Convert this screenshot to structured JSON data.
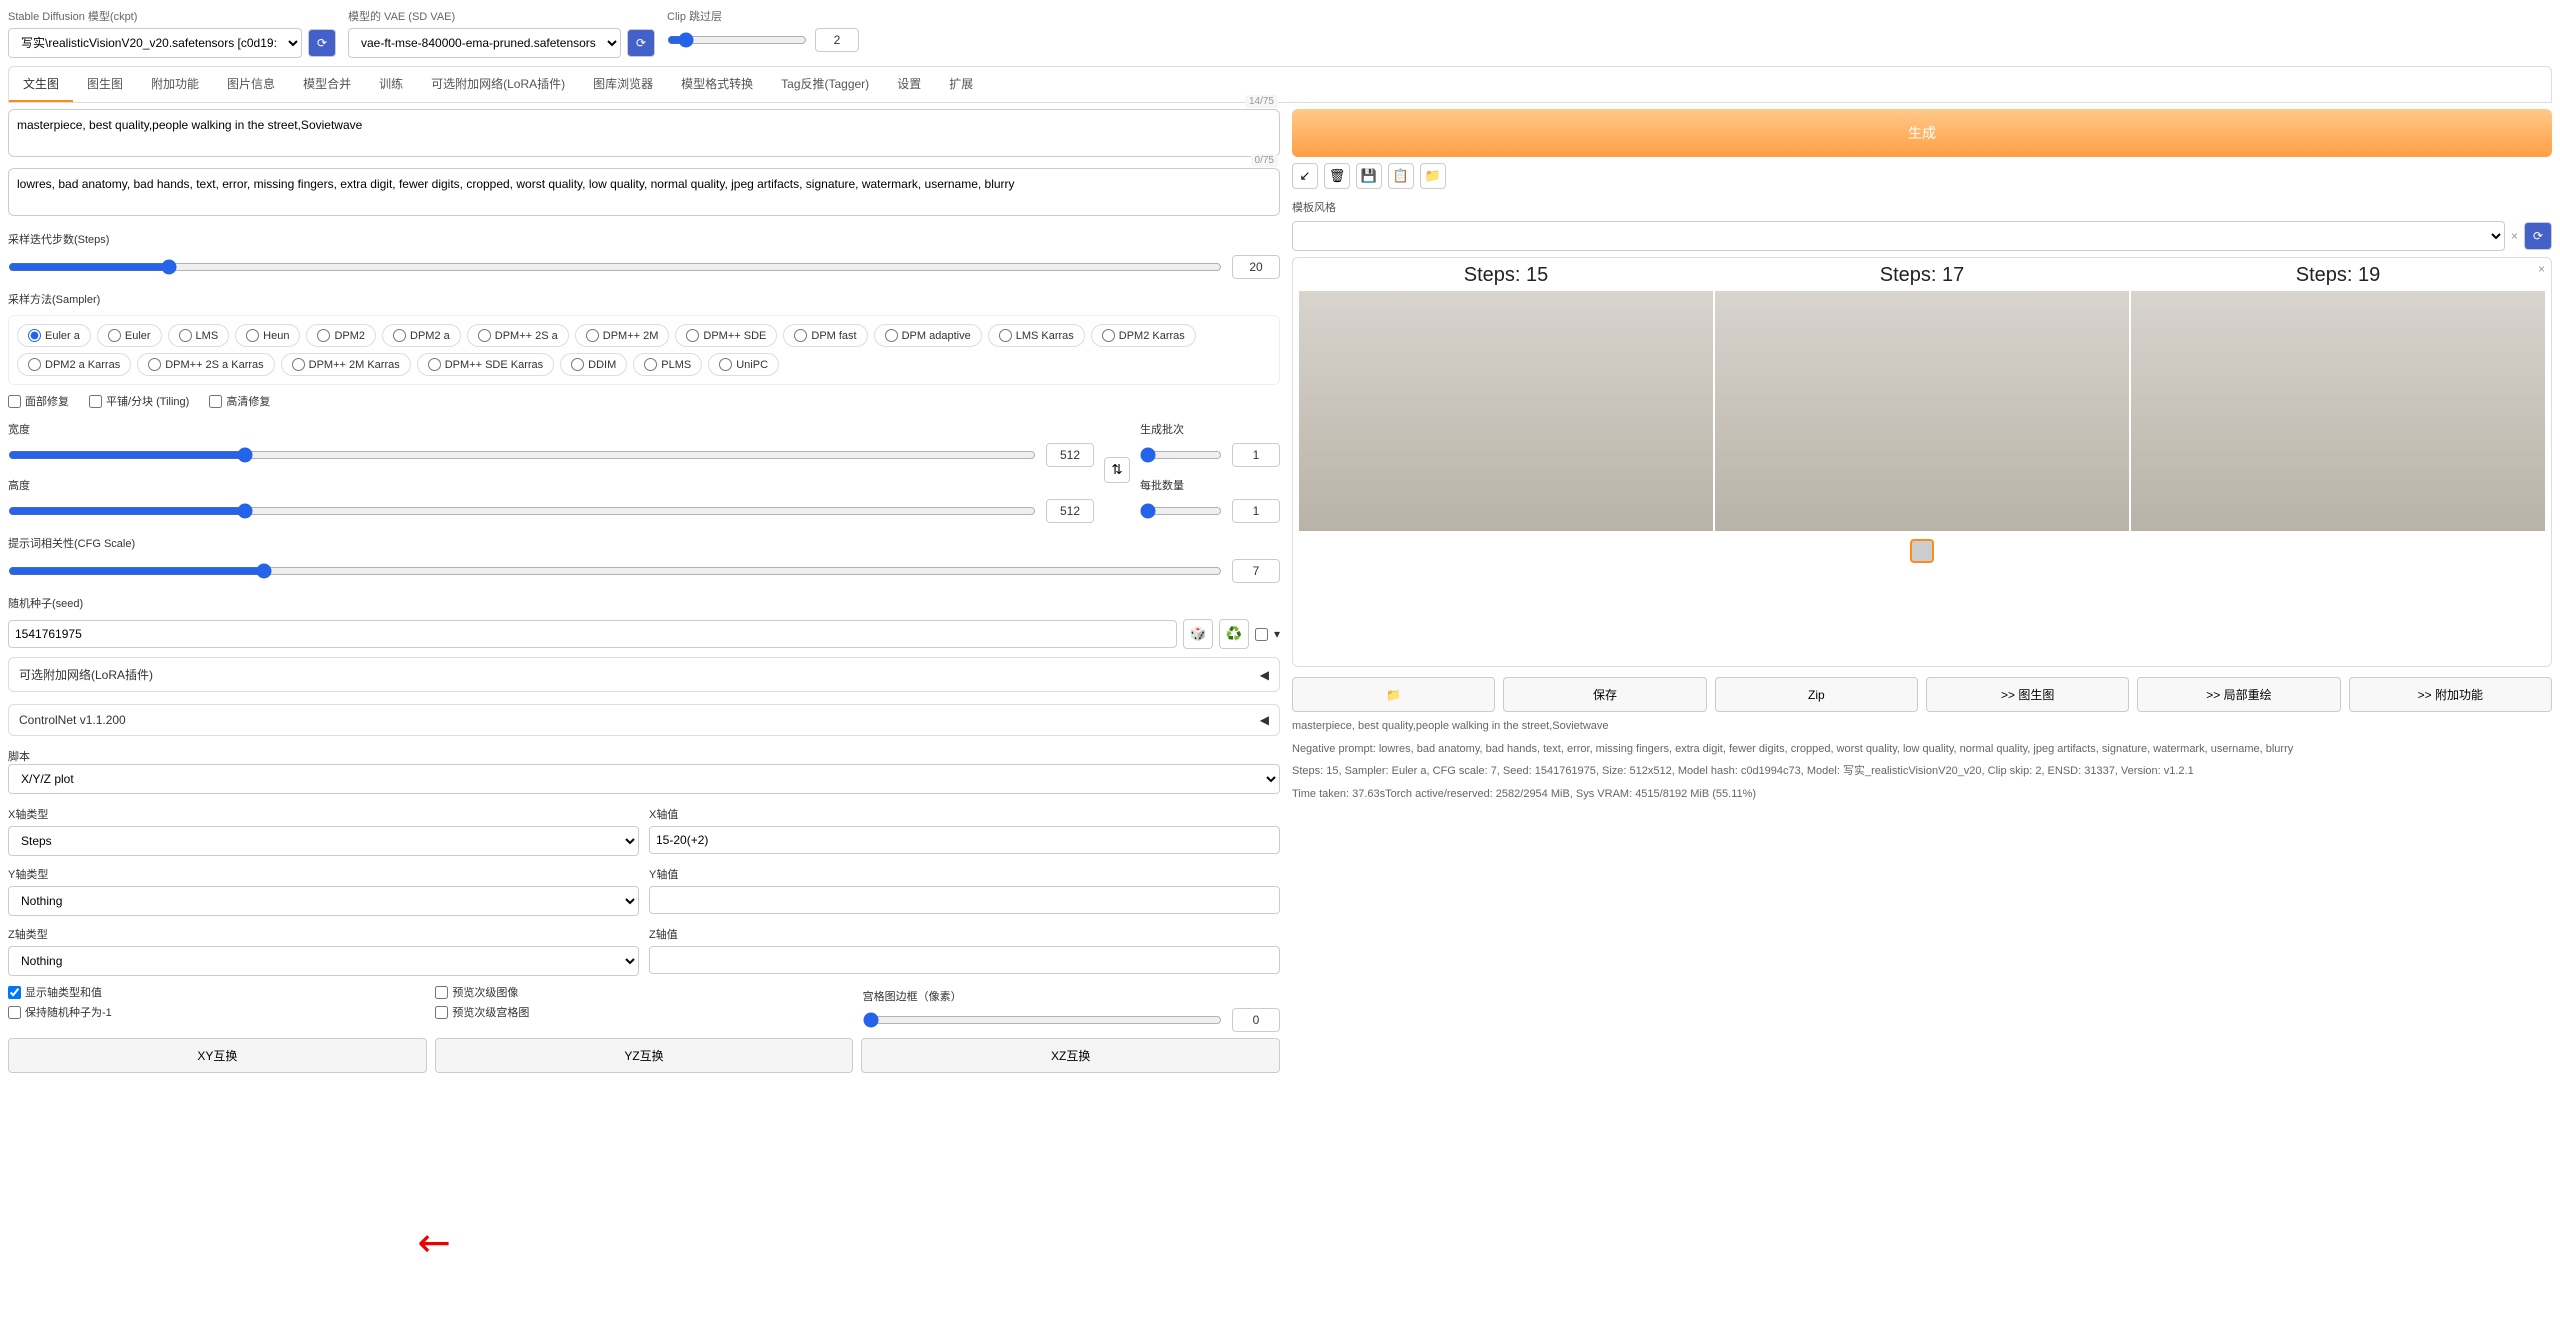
{
  "top": {
    "model_label": "Stable Diffusion 模型(ckpt)",
    "model_value": "写实\\realisticVisionV20_v20.safetensors [c0d19:",
    "vae_label": "模型的 VAE (SD VAE)",
    "vae_value": "vae-ft-mse-840000-ema-pruned.safetensors",
    "clip_label": "Clip 跳过层",
    "clip_value": "2"
  },
  "tabs": [
    "文生图",
    "图生图",
    "附加功能",
    "图片信息",
    "模型合并",
    "训练",
    "可选附加网络(LoRA插件)",
    "图库浏览器",
    "模型格式转换",
    "Tag反推(Tagger)",
    "设置",
    "扩展"
  ],
  "prompt": {
    "positive": "masterpiece, best quality,people walking in the street,Sovietwave",
    "positive_count": "14/75",
    "negative": "lowres, bad anatomy, bad hands, text, error, missing fingers, extra digit, fewer digits, cropped, worst quality, low quality, normal quality, jpeg artifacts, signature, watermark, username, blurry",
    "negative_count": "0/75"
  },
  "params": {
    "steps_label": "采样迭代步数(Steps)",
    "steps": "20",
    "sampler_label": "采样方法(Sampler)",
    "samplers": [
      "Euler a",
      "Euler",
      "LMS",
      "Heun",
      "DPM2",
      "DPM2 a",
      "DPM++ 2S a",
      "DPM++ 2M",
      "DPM++ SDE",
      "DPM fast",
      "DPM adaptive",
      "LMS Karras",
      "DPM2 Karras",
      "DPM2 a Karras",
      "DPM++ 2S a Karras",
      "DPM++ 2M Karras",
      "DPM++ SDE Karras",
      "DDIM",
      "PLMS",
      "UniPC"
    ],
    "face_restore": "面部修复",
    "tiling": "平铺/分块 (Tiling)",
    "hires": "高清修复",
    "width_label": "宽度",
    "width": "512",
    "height_label": "高度",
    "height": "512",
    "batch_count_label": "生成批次",
    "batch_count": "1",
    "batch_size_label": "每批数量",
    "batch_size": "1",
    "cfg_label": "提示词相关性(CFG Scale)",
    "cfg": "7",
    "seed_label": "随机种子(seed)",
    "seed": "1541761975"
  },
  "accordions": {
    "lora": "可选附加网络(LoRA插件)",
    "controlnet": "ControlNet v1.1.200"
  },
  "script": {
    "label": "脚本",
    "value": "X/Y/Z plot",
    "x_type_label": "X轴类型",
    "x_type": "Steps",
    "x_val_label": "X轴值",
    "x_val": "15-20(+2)",
    "y_type_label": "Y轴类型",
    "y_type": "Nothing",
    "y_val_label": "Y轴值",
    "y_val": "",
    "z_type_label": "Z轴类型",
    "z_type": "Nothing",
    "z_val_label": "Z轴值",
    "z_val": "",
    "show_legend": "显示轴类型和值",
    "include_sub": "预览次级图像",
    "keep_seed": "保持随机种子为-1",
    "include_grid": "预览次级宫格图",
    "margin_label": "宫格图边框（像素）",
    "margin": "0",
    "swap_xy": "XY互换",
    "swap_yz": "YZ互换",
    "swap_xz": "XZ互换"
  },
  "right": {
    "generate": "生成",
    "style_label": "模板风格",
    "style_clear": "×",
    "btn_folder": "📁",
    "btn_save": "保存",
    "btn_zip": "Zip",
    "btn_i2i": ">> 图生图",
    "btn_inpaint": ">> 局部重绘",
    "btn_extra": ">> 附加功能",
    "result_labels": [
      "Steps: 15",
      "Steps: 17",
      "Steps: 19"
    ],
    "info1": "masterpiece, best quality,people walking in the street,Sovietwave",
    "info2": "Negative prompt: lowres, bad anatomy, bad hands, text, error, missing fingers, extra digit, fewer digits, cropped, worst quality, low quality, normal quality, jpeg artifacts, signature, watermark, username, blurry",
    "info3": "Steps: 15, Sampler: Euler a, CFG scale: 7, Seed: 1541761975, Size: 512x512, Model hash: c0d1994c73, Model: 写实_realisticVisionV20_v20, Clip skip: 2, ENSD: 31337, Version: v1.2.1",
    "info4": "Time taken: 37.63sTorch active/reserved: 2582/2954 MiB, Sys VRAM: 4515/8192 MiB (55.11%)"
  }
}
